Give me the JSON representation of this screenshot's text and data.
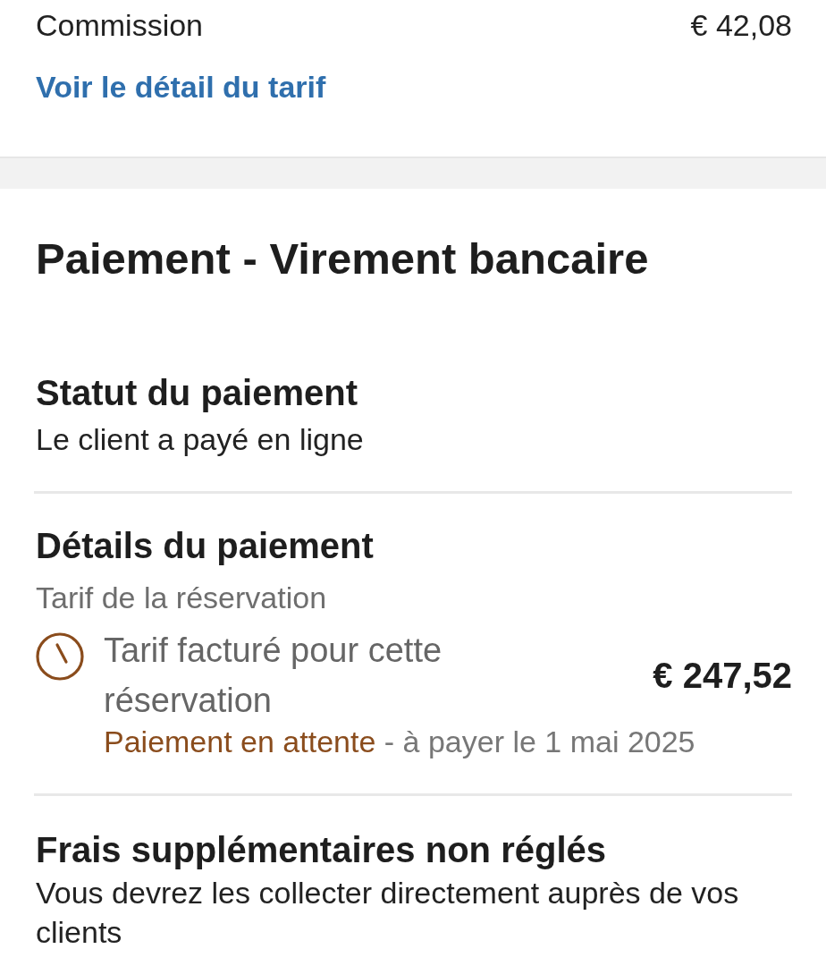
{
  "summary": {
    "rows": [
      {
        "label": "Commission",
        "value": "€ 42,08"
      }
    ],
    "link": "Voir le détail du tarif"
  },
  "payment": {
    "title": "Paiement - Virement bancaire",
    "status": {
      "heading": "Statut du paiement",
      "text": "Le client a payé en ligne"
    },
    "details": {
      "heading": "Détails du paiement",
      "subheading": "Tarif de la réservation",
      "items": [
        {
          "label": "Tarif facturé pour cette réservation",
          "amount": "€ 247,52",
          "status": {
            "kind": "pending",
            "label": "Paiement en attente"
          },
          "due": "- à payer le 1 mai 2025"
        }
      ]
    },
    "extra_fees": {
      "heading": "Frais supplémentaires non réglés",
      "text": "Vous devrez les collecter directement auprès de vos clients"
    }
  }
}
